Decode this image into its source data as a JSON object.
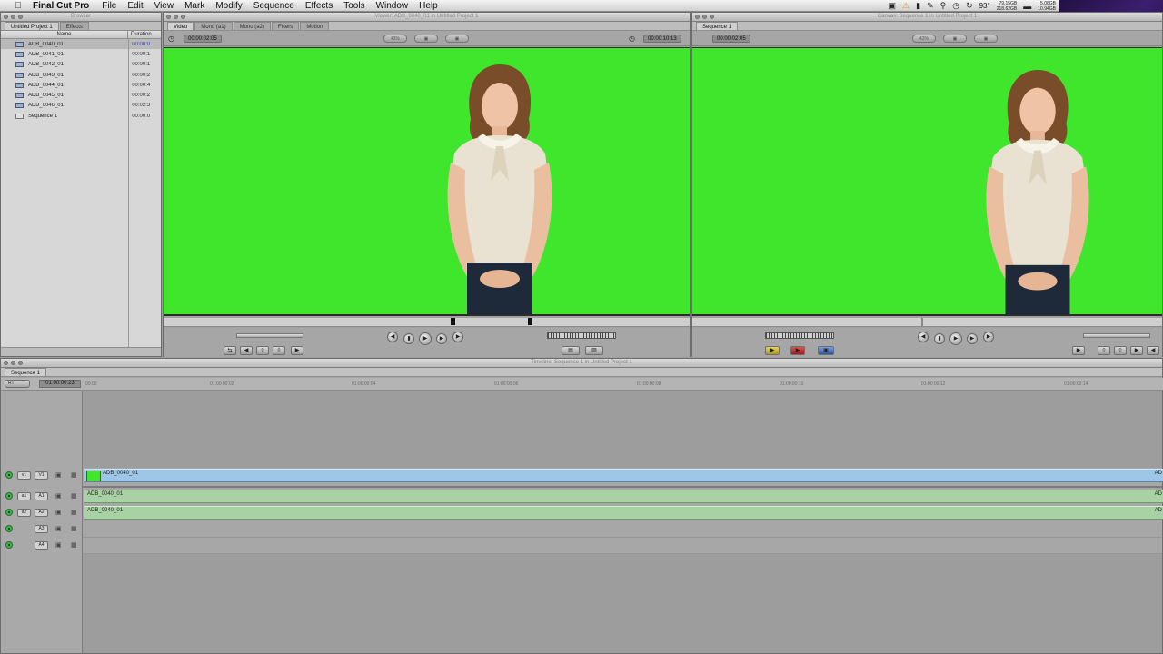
{
  "menubar": {
    "app_name": "Final Cut Pro",
    "items": [
      "File",
      "Edit",
      "View",
      "Mark",
      "Modify",
      "Sequence",
      "Effects",
      "Tools",
      "Window",
      "Help"
    ],
    "status": {
      "temperature": "93°",
      "mem_top": "79.15GB",
      "mem_bottom": "218.62GB",
      "ram_top": "5.06GB",
      "ram_bottom": "10.94GB"
    }
  },
  "browser": {
    "title": "Browser",
    "tabs": [
      "Untitled Project 1",
      "Effects"
    ],
    "col_name": "Name",
    "col_duration": "Duration",
    "items": [
      {
        "name": "ADB_0040_01",
        "duration": "00:00:0",
        "type": "clip"
      },
      {
        "name": "ADB_0041_01",
        "duration": "00:00:1",
        "type": "clip"
      },
      {
        "name": "ADB_0042_01",
        "duration": "00:00:1",
        "type": "clip"
      },
      {
        "name": "ADB_0043_01",
        "duration": "00:00:2",
        "type": "clip"
      },
      {
        "name": "ADB_0044_01",
        "duration": "00:00:4",
        "type": "clip"
      },
      {
        "name": "ADB_0045_01",
        "duration": "00:00:2",
        "type": "clip"
      },
      {
        "name": "ADB_0046_01",
        "duration": "00:02:3",
        "type": "clip"
      },
      {
        "name": "Sequence 1",
        "duration": "00:00:0",
        "type": "sequence"
      }
    ]
  },
  "viewer": {
    "title": "Viewer: ADB_0040_01 in Untitled Project 1",
    "tabs": [
      "Video",
      "Mono (a1)",
      "Mono (a2)",
      "Filters",
      "Motion"
    ],
    "duration_tc": "00:00:02:05",
    "current_tc": "00:00:10:13",
    "zoom": "43%"
  },
  "canvas": {
    "title": "Canvas: Sequence 1 in Untitled Project 1",
    "tab": "Sequence 1",
    "duration_tc": "00:00:02:05",
    "zoom": "43%"
  },
  "timeline": {
    "title": "Timeline: Sequence 1 in Untitled Project 1",
    "tab": "Sequence 1",
    "rt_label": "RT",
    "current_tc": "01:00:00:23",
    "ruler_ticks": [
      "00:00",
      "01:00:00:02",
      "01:00:00:04",
      "01:00:00:06",
      "01:00:00:08",
      "01:00:00:10",
      "01:00:00:12",
      "01:00:00:14"
    ],
    "tracks": [
      {
        "src": "v1",
        "dst": "V1",
        "clip": "ADB_0040_01",
        "kind": "video",
        "end_label": "AD"
      },
      {
        "src": "a1",
        "dst": "A1",
        "clip": "ADB_0040_01",
        "kind": "audio",
        "end_label": "AD"
      },
      {
        "src": "a2",
        "dst": "A2",
        "clip": "ADB_0040_01",
        "kind": "audio",
        "end_label": "AD"
      },
      {
        "src": "",
        "dst": "A3",
        "clip": "",
        "kind": "empty",
        "end_label": ""
      },
      {
        "src": "",
        "dst": "A4",
        "clip": "",
        "kind": "empty",
        "end_label": ""
      }
    ]
  },
  "colors": {
    "greenscreen": "#40e62c",
    "video_clip": "#9ec6e6",
    "audio_clip": "#a9d2a4"
  }
}
